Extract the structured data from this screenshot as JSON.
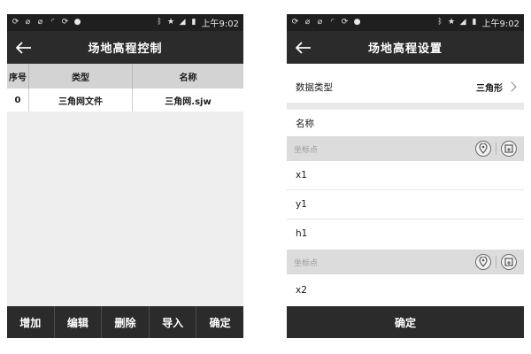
{
  "status_bar": {
    "time": "上午9:02",
    "icons_left": [
      "sync-icon",
      "mute-icon",
      "mute-icon",
      "wifi-icon",
      "sync-icon",
      "location-icon"
    ],
    "icons_right": [
      "bluetooth-icon",
      "star-icon",
      "signal-icon",
      "battery-icon"
    ]
  },
  "left_screen": {
    "title": "场地高程控制",
    "table": {
      "headers": [
        "序号",
        "类型",
        "名称"
      ],
      "rows": [
        [
          "0",
          "三角网文件",
          "三角网.sjw"
        ]
      ]
    },
    "buttons": [
      "增加",
      "编辑",
      "删除",
      "导入",
      "确定"
    ]
  },
  "right_screen": {
    "title": "场地高程设置",
    "data_type_label": "数据类型",
    "data_type_value": "三角形",
    "name_label": "名称",
    "section1_placeholder": "坐标点",
    "x1_label": "x1",
    "y1_label": "y1",
    "h1_label": "h1",
    "section2_placeholder": "坐标点",
    "x2_label": "x2",
    "confirm": "确定"
  },
  "colors": {
    "bar_dark": "#2b2b2b",
    "status_bar": "#1f1f1f",
    "header_gray": "#d3d3d3"
  }
}
